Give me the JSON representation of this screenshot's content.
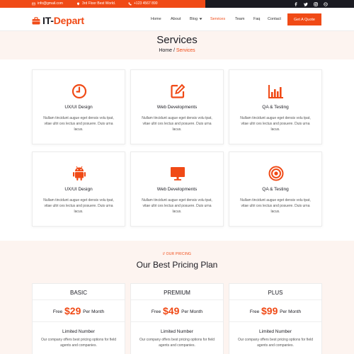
{
  "topbar": {
    "email": "info@gmail.com",
    "address": "3rd Floor Best World.",
    "phone": "+123 4567 890",
    "social_icons": [
      "facebook-icon",
      "twitter-icon",
      "instagram-icon",
      "dribbble-icon"
    ]
  },
  "brand": {
    "logo_prefix": "IT-",
    "logo_suffix": "Depart",
    "accent_color": "#f04a16",
    "dark_color": "#1b1b22"
  },
  "nav": {
    "items": [
      "Home",
      "About",
      "Blog",
      "Services",
      "Team",
      "Faq",
      "Contact"
    ],
    "active": "Services",
    "cta_label": "Get A Quote"
  },
  "page_header": {
    "title": "Services",
    "breadcrumb_home": "Home",
    "breadcrumb_sep": " / ",
    "breadcrumb_current": "Services"
  },
  "services": [
    {
      "icon": "clock-icon",
      "title": "UX/UI Design",
      "desc": "Nullam tincidunt augue eget densis volu tpat, vitae ultri ces lectus and posuere. Duis urna lacus."
    },
    {
      "icon": "edit-icon",
      "title": "Web Developments",
      "desc": "Nullam tincidunt augue eget densis volu tpat, vitae ultri ces lectus and posuere. Duis urna lacus."
    },
    {
      "icon": "bar-chart-icon",
      "title": "QA & Testing",
      "desc": "Nullam tincidunt augue eget densis volu tpat, vitae ultri ces lectus and posuere. Duis urna lacus."
    },
    {
      "icon": "android-icon",
      "title": "UX/UI Design",
      "desc": "Nullam tincidunt augue eget densis volu tpat, vitae ultri ces lectus and posuere. Duis urna lacus."
    },
    {
      "icon": "monitor-icon",
      "title": "Web Developments",
      "desc": "Nullam tincidunt augue eget densis volu tpat, vitae ultri ces lectus and posuere. Duis urna lacus."
    },
    {
      "icon": "target-icon",
      "title": "QA & Testing",
      "desc": "Nullam tincidunt augue eget densis volu tpat, vitae ultri ces lectus and posuere. Duis urna lacus."
    }
  ],
  "pricing": {
    "tag": "// OUR PRICING",
    "title": "Our Best Pricing Plan",
    "plans": [
      {
        "name": "BASIC",
        "price_prefix": "Free",
        "amount": "$29",
        "period": "Per Month",
        "feature_title": "Limited Number",
        "feature_desc": "Our company offers best pricing options for field agents and companies."
      },
      {
        "name": "PREMIUM",
        "price_prefix": "Free",
        "amount": "$49",
        "period": "Per Month",
        "feature_title": "Limited Number",
        "feature_desc": "Our company offers best pricing options for field agents and companies."
      },
      {
        "name": "PLUS",
        "price_prefix": "Free",
        "amount": "$99",
        "period": "Per Month",
        "feature_title": "Limited Number",
        "feature_desc": "Our company offers best pricing options for field agents and companies."
      }
    ]
  }
}
